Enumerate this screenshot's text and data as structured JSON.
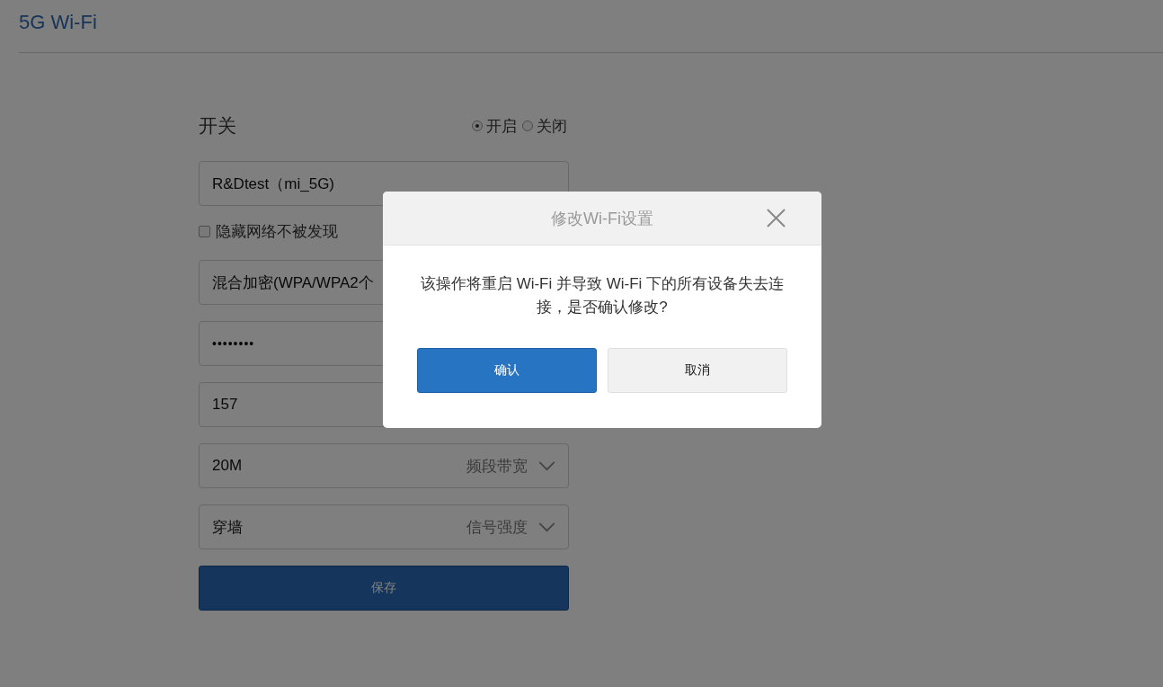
{
  "page": {
    "title": "5G Wi-Fi"
  },
  "form": {
    "switch": {
      "label": "开关",
      "options": [
        {
          "label": "开启",
          "selected": true
        },
        {
          "label": "关闭",
          "selected": false
        }
      ]
    },
    "fields": [
      {
        "kind": "text",
        "value": "R&Dtest（mi_5G)"
      },
      {
        "kind": "checkbox",
        "label": "隐藏网络不被发现",
        "checked": false
      },
      {
        "kind": "text",
        "value": "混合加密(WPA/WPA2个"
      },
      {
        "kind": "password",
        "value": "••••••••"
      },
      {
        "kind": "text",
        "value": "157"
      },
      {
        "kind": "select",
        "value": "20M",
        "label": "频段带宽"
      },
      {
        "kind": "select",
        "value": "穿墙",
        "label": "信号强度"
      }
    ],
    "save": "保存"
  },
  "dialog": {
    "title": "修改Wi-Fi设置",
    "message": "该操作将重启 Wi-Fi 并导致 Wi-Fi 下的所有设备失去连接，是否确认修改?",
    "buttons": [
      {
        "label": "确认",
        "kind": "primary"
      },
      {
        "label": "取消",
        "kind": "secondary"
      }
    ]
  }
}
